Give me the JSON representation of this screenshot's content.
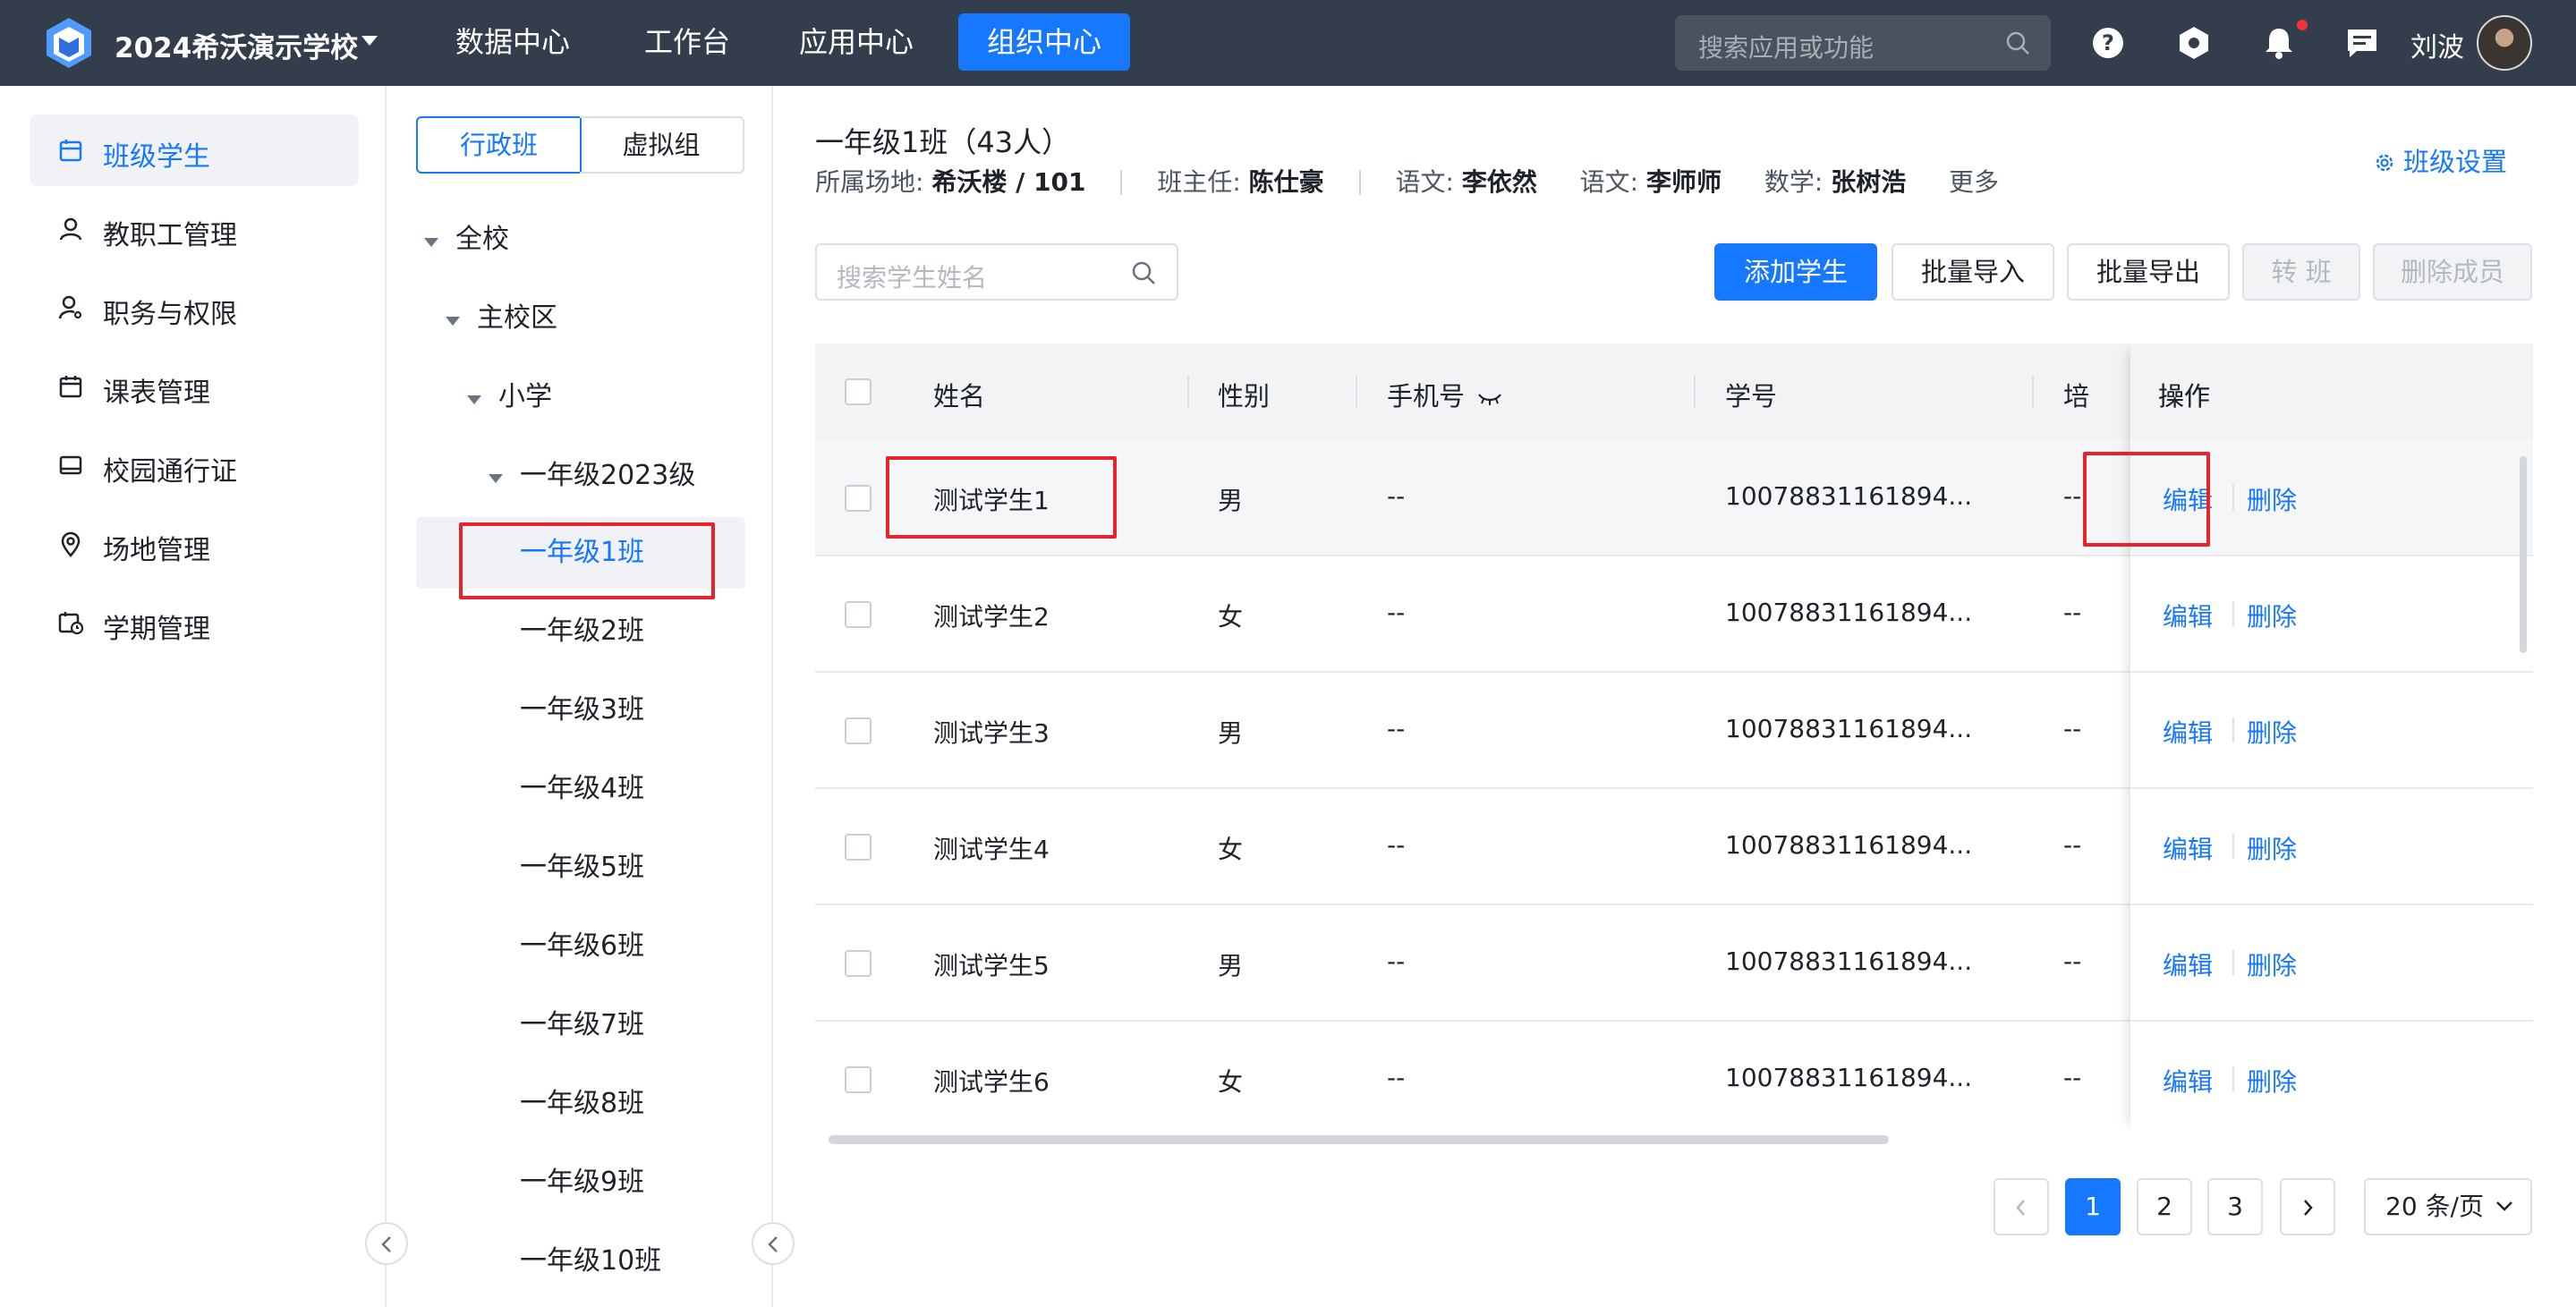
{
  "topbar": {
    "school_name": "2024希沃演示学校",
    "nav": [
      "数据中心",
      "工作台",
      "应用中心",
      "组织中心"
    ],
    "active_nav": "组织中心",
    "search_placeholder": "搜索应用或功能",
    "user_name": "刘波"
  },
  "sidebar": {
    "items": [
      {
        "label": "班级学生",
        "icon": "class-icon",
        "active": true
      },
      {
        "label": "教职工管理",
        "icon": "person-icon"
      },
      {
        "label": "职务与权限",
        "icon": "person-key-icon"
      },
      {
        "label": "课表管理",
        "icon": "calendar-icon"
      },
      {
        "label": "校园通行证",
        "icon": "card-icon"
      },
      {
        "label": "场地管理",
        "icon": "location-icon"
      },
      {
        "label": "学期管理",
        "icon": "calendar-clock-icon"
      }
    ]
  },
  "tree": {
    "tabs": [
      "行政班",
      "虚拟组"
    ],
    "nodes": [
      "全校",
      "主校区",
      "小学",
      "一年级2023级",
      "一年级1班",
      "一年级2班",
      "一年级3班",
      "一年级4班",
      "一年级5班",
      "一年级6班",
      "一年级7班",
      "一年级8班",
      "一年级9班",
      "一年级10班"
    ]
  },
  "class_info": {
    "title": "一年级1班（43人）",
    "location_label": "所属场地:",
    "location_value": "希沃楼 / 101",
    "head_teacher_label": "班主任:",
    "head_teacher_value": "陈仕豪",
    "teachers": [
      {
        "label": "语文:",
        "value": "李依然"
      },
      {
        "label": "语文:",
        "value": "李师师"
      },
      {
        "label": "数学:",
        "value": "张树浩"
      }
    ],
    "more": "更多",
    "settings": "班级设置"
  },
  "toolbar": {
    "search_placeholder": "搜索学生姓名",
    "add": "添加学生",
    "import": "批量导入",
    "export": "批量导出",
    "transfer": "转 班",
    "remove": "删除成员"
  },
  "table": {
    "headers": {
      "name": "姓名",
      "gender": "性别",
      "phone": "手机号",
      "student_id": "学号",
      "train": "培",
      "actions": "操作"
    },
    "rows": [
      {
        "name": "测试学生1",
        "gender": "男",
        "phone": "--",
        "student_id": "10078831161894...",
        "extra": "--"
      },
      {
        "name": "测试学生2",
        "gender": "女",
        "phone": "--",
        "student_id": "10078831161894...",
        "extra": "--"
      },
      {
        "name": "测试学生3",
        "gender": "男",
        "phone": "--",
        "student_id": "10078831161894...",
        "extra": "--"
      },
      {
        "name": "测试学生4",
        "gender": "女",
        "phone": "--",
        "student_id": "10078831161894...",
        "extra": "--"
      },
      {
        "name": "测试学生5",
        "gender": "男",
        "phone": "--",
        "student_id": "10078831161894...",
        "extra": "--"
      },
      {
        "name": "测试学生6",
        "gender": "女",
        "phone": "--",
        "student_id": "10078831161894...",
        "extra": "--"
      }
    ],
    "edit_label": "编辑",
    "delete_label": "删除"
  },
  "pagination": {
    "pages": [
      "1",
      "2",
      "3"
    ],
    "current": "1",
    "page_size": "20 条/页"
  },
  "colors": {
    "accent": "#1677ff",
    "topbar": "#343d4c",
    "highlight": "#e5242b"
  }
}
